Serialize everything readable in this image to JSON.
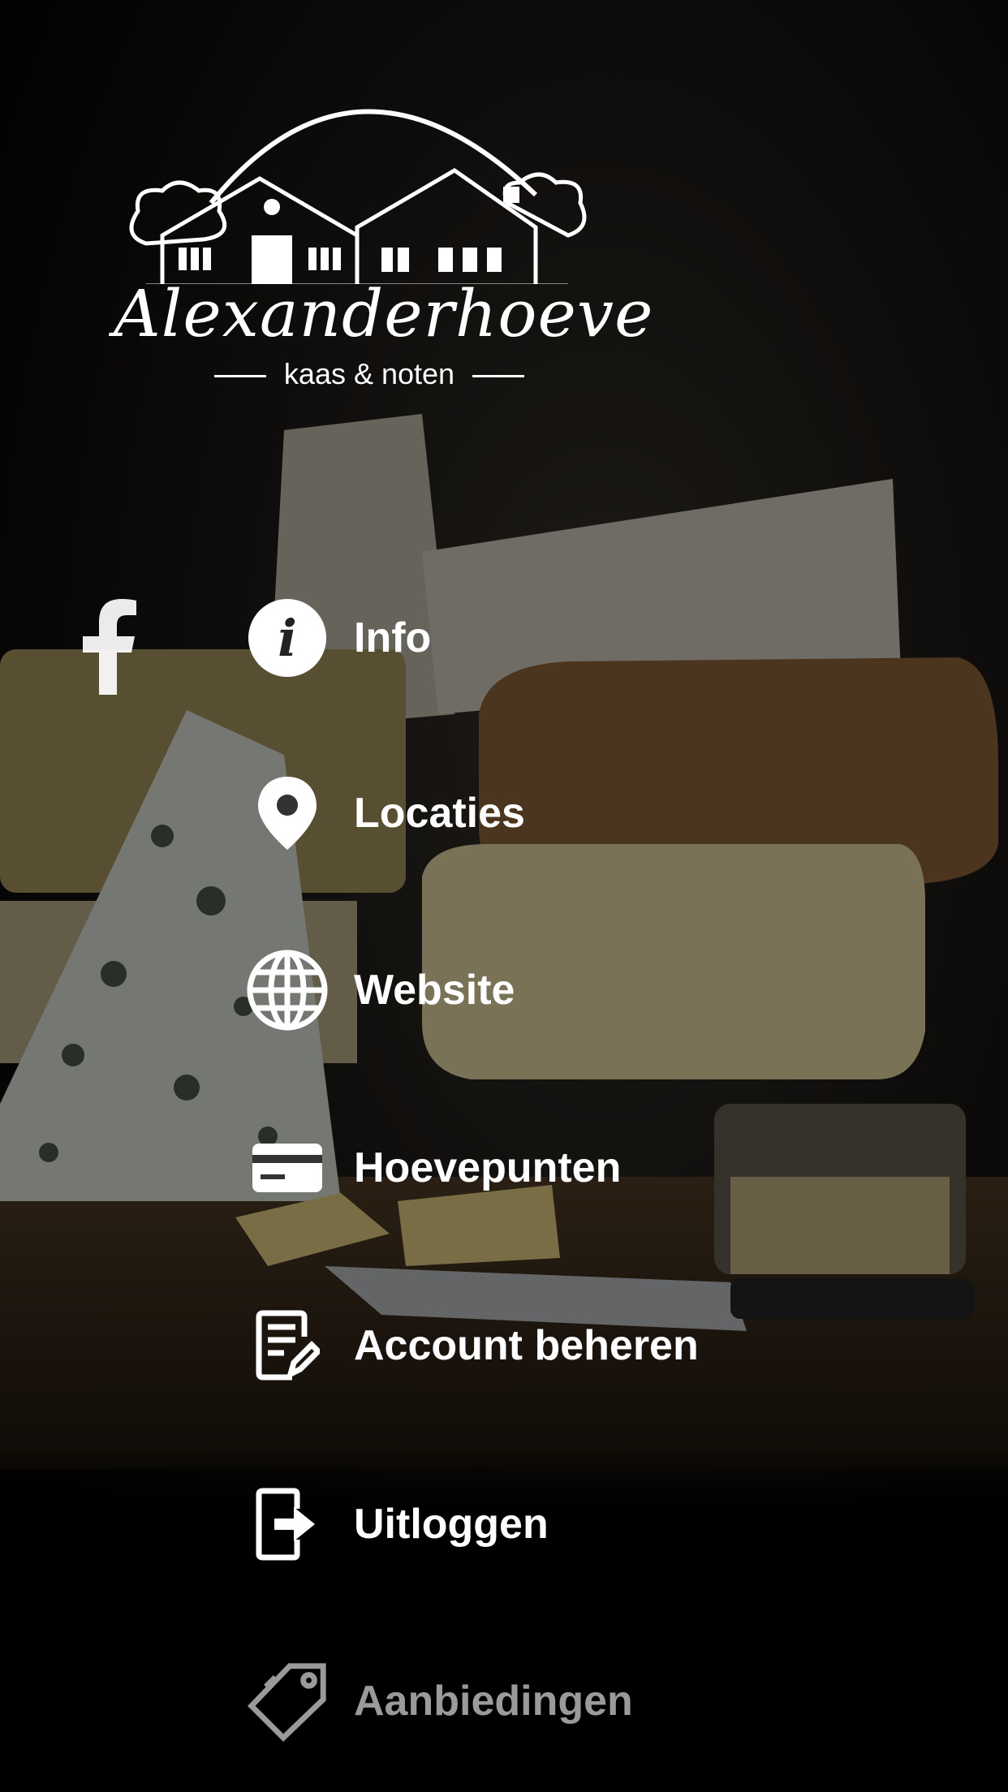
{
  "brand": {
    "name": "Alexanderhoeve",
    "tagline": "kaas & noten"
  },
  "social": {
    "icon": "facebook-icon"
  },
  "menu": {
    "items": [
      {
        "label": "Info",
        "icon": "info-icon",
        "enabled": true
      },
      {
        "label": "Locaties",
        "icon": "location-pin-icon",
        "enabled": true
      },
      {
        "label": "Website",
        "icon": "globe-icon",
        "enabled": true
      },
      {
        "label": "Hoevepunten",
        "icon": "card-icon",
        "enabled": true
      },
      {
        "label": "Account beheren",
        "icon": "edit-document-icon",
        "enabled": true
      },
      {
        "label": "Uitloggen",
        "icon": "logout-icon",
        "enabled": true
      },
      {
        "label": "Aanbiedingen",
        "icon": "tag-icon",
        "enabled": false
      }
    ]
  },
  "colors": {
    "text": "#ffffff",
    "muted": "#9a9a9a",
    "background": "#000000"
  }
}
